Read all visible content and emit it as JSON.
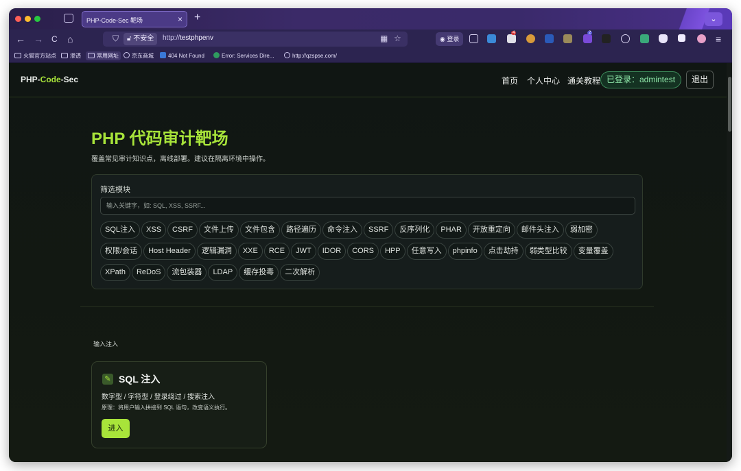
{
  "browser": {
    "tab_title": "PHP-Code-Sec 靶场",
    "tab_close": "×",
    "new_tab": "+",
    "tab_list_icon": "⌄",
    "nav": {
      "back": "←",
      "forward": "→",
      "reload": "C",
      "home": "⌂"
    },
    "security_label": "不安全",
    "url_prefix": "http://",
    "url_host": "testphpenv",
    "login_label": "登录",
    "bookmarks": [
      {
        "label": "火狐官方站点",
        "icon": "folder-icon"
      },
      {
        "label": "渗透",
        "icon": "folder-icon"
      },
      {
        "label": "常用网址",
        "icon": "folder-icon"
      },
      {
        "label": "京东商城",
        "icon": "globe-icon"
      },
      {
        "label": "404 Not Found",
        "icon": "checkbox-icon"
      },
      {
        "label": "Error: Services Dire...",
        "icon": "extension-icon"
      },
      {
        "label": "http://qzspse.com/",
        "icon": "globe-icon"
      }
    ],
    "ext_badges": [
      "4",
      "2"
    ]
  },
  "header": {
    "brand_a": "PHP-",
    "brand_b": "Code",
    "brand_c": "-Sec",
    "nav": [
      "首页",
      "个人中心",
      "通关教程"
    ],
    "user_badge": "已登录：admintest",
    "logout": "退出"
  },
  "hero": {
    "title": "PHP 代码审计靶场",
    "subtitle": "覆盖常见审计知识点，离线部署。建议在隔离环境中操作。"
  },
  "filter": {
    "label": "筛选模块",
    "placeholder": "输入关键字，如: SQL, XSS, SSRF...",
    "chips": [
      "SQL注入",
      "XSS",
      "CSRF",
      "文件上传",
      "文件包含",
      "路径遍历",
      "命令注入",
      "SSRF",
      "反序列化",
      "PHAR",
      "开放重定向",
      "邮件头注入",
      "弱加密",
      "权限/会话",
      "Host Header",
      "逻辑漏洞",
      "XXE",
      "RCE",
      "JWT",
      "IDOR",
      "CORS",
      "HPP",
      "任意写入",
      "phpinfo",
      "点击劫持",
      "弱类型比较",
      "变量覆盖",
      "XPath",
      "ReDoS",
      "流包装器",
      "LDAP",
      "缓存投毒",
      "二次解析"
    ]
  },
  "section": {
    "label": "输入注入",
    "card": {
      "icon": "pencil-icon",
      "title": "SQL 注入",
      "subtitle": "数字型 / 字符型 / 登录绕过 / 搜索注入",
      "description": "原理：将用户输入拼接到 SQL 语句，改变语义执行。",
      "button": "进入"
    }
  },
  "colors": {
    "accent": "#a8e43a",
    "success": "#8ee6a8",
    "background": "#101613"
  }
}
